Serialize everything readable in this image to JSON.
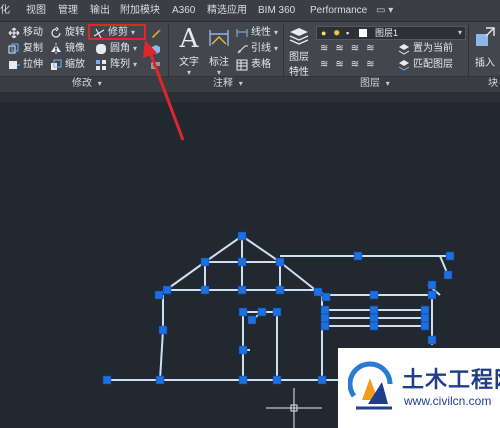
{
  "tabs": [
    "化",
    "视图",
    "管理",
    "输出",
    "附加模块",
    "A360",
    "精选应用",
    "BIM 360",
    "Performance"
  ],
  "modify_panel": {
    "label": "修改",
    "items": {
      "move": "移动",
      "rotate": "旋转",
      "trim": "修剪",
      "copy": "复制",
      "mirror": "镜像",
      "fillet": "圆角",
      "stretch": "拉伸",
      "scale": "缩放",
      "array": "阵列"
    }
  },
  "annotation_panel": {
    "label": "注释",
    "text": "文字",
    "dimension": "标注",
    "linear": "线性",
    "leader": "引线",
    "table": "表格"
  },
  "layers_panel": {
    "label": "图层",
    "layer_properties": [
      "图层",
      "特性"
    ],
    "current_layer": "图层1",
    "set_current": "置为当前",
    "match_layer": "匹配图层"
  },
  "insert_panel": {
    "insert": "插入",
    "label": "块"
  },
  "watermark": {
    "title": "土木工程网",
    "url": "www.civilcn.com"
  },
  "colors": {
    "canvas": "#212830",
    "ribbon": "#43474d",
    "highlight": "#e0262b",
    "selection_grip": "#1e6fe0",
    "geometry": "#cfe0f4"
  }
}
